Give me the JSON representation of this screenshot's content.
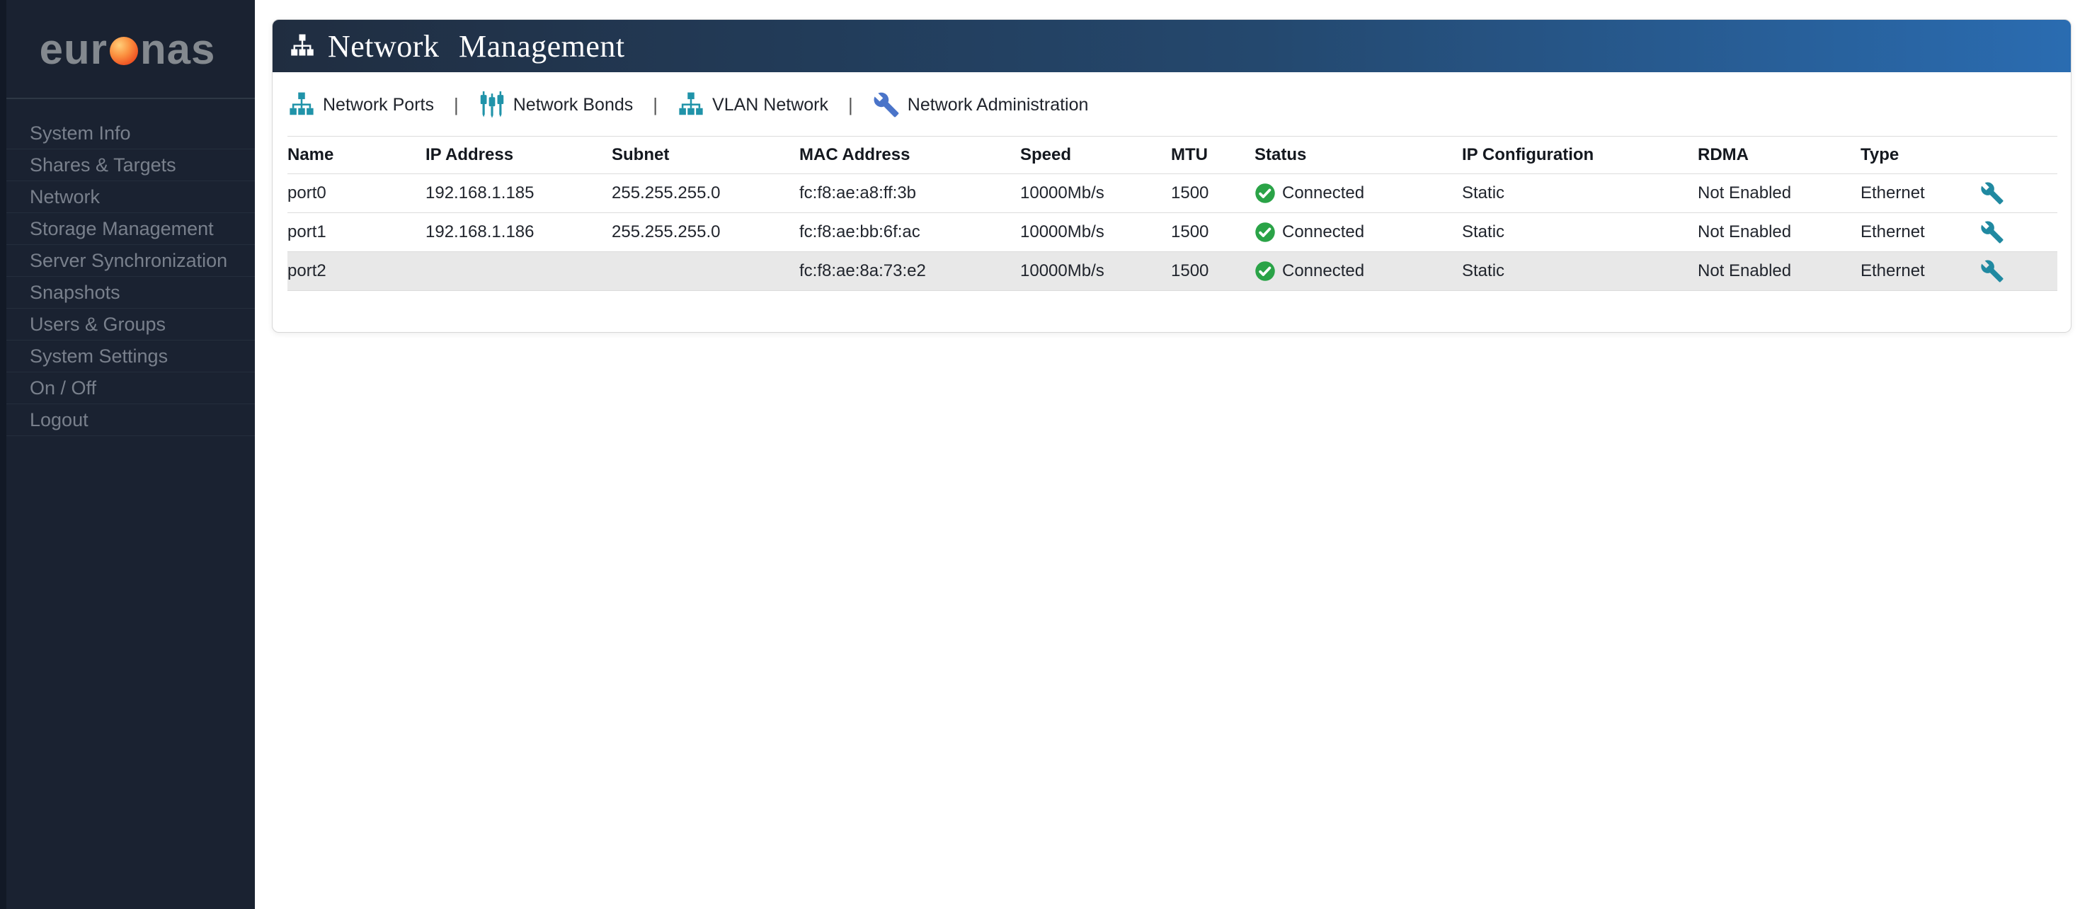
{
  "sidebar": {
    "logo": {
      "pre": "eur",
      "post": "nas"
    },
    "items": [
      "System Info",
      "Shares & Targets",
      "Network",
      "Storage Management",
      "Server Synchronization",
      "Snapshots",
      "Users & Groups",
      "System Settings",
      "On / Off",
      "Logout"
    ]
  },
  "header": {
    "title": "Network Management"
  },
  "toolbar": {
    "separator": "|",
    "items": [
      {
        "label": "Network Ports",
        "icon": "network-tree-icon"
      },
      {
        "label": "Network Bonds",
        "icon": "network-bonds-icon"
      },
      {
        "label": "VLAN Network",
        "icon": "network-tree-icon"
      },
      {
        "label": "Network Administration",
        "icon": "wrench-icon"
      }
    ]
  },
  "table": {
    "columns": [
      "Name",
      "IP Address",
      "Subnet",
      "MAC Address",
      "Speed",
      "MTU",
      "Status",
      "IP Configuration",
      "RDMA",
      "Type",
      ""
    ],
    "rows": [
      {
        "name": "port0",
        "ip": "192.168.1.185",
        "subnet": "255.255.255.0",
        "mac": "fc:f8:ae:a8:ff:3b",
        "speed": "10000Mb/s",
        "mtu": "1500",
        "status": "Connected",
        "ip_config": "Static",
        "rdma": "Not Enabled",
        "type": "Ethernet",
        "highlighted": false
      },
      {
        "name": "port1",
        "ip": "192.168.1.186",
        "subnet": "255.255.255.0",
        "mac": "fc:f8:ae:bb:6f:ac",
        "speed": "10000Mb/s",
        "mtu": "1500",
        "status": "Connected",
        "ip_config": "Static",
        "rdma": "Not Enabled",
        "type": "Ethernet",
        "highlighted": false
      },
      {
        "name": "port2",
        "ip": "",
        "subnet": "",
        "mac": "fc:f8:ae:8a:73:e2",
        "speed": "10000Mb/s",
        "mtu": "1500",
        "status": "Connected",
        "ip_config": "Static",
        "rdma": "Not Enabled",
        "type": "Ethernet",
        "highlighted": true
      }
    ]
  },
  "colors": {
    "sidebar_bg": "#1a2231",
    "sidebar_text": "#79808c",
    "logo_orange": "#f05423",
    "header_gradient_from": "#202d40",
    "header_gradient_to": "#2a6cb1",
    "accent_teal": "#2093a9",
    "accent_blue": "#4a74c9",
    "status_connected_green": "#2aa347",
    "highlight_row_bg": "#e8e8e8"
  }
}
